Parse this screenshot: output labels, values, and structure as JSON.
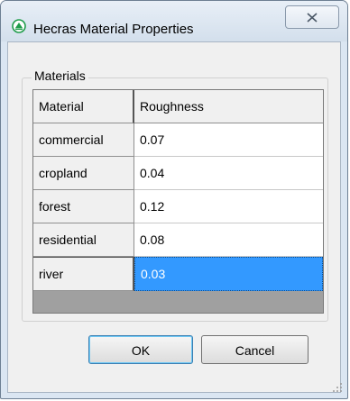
{
  "window": {
    "title": "Hecras Material Properties",
    "close_symbol": "✕"
  },
  "group": {
    "label": "Materials"
  },
  "table": {
    "columns": [
      "Material",
      "Roughness"
    ],
    "rows": [
      {
        "material": "commercial",
        "roughness": "0.07"
      },
      {
        "material": "cropland",
        "roughness": "0.04"
      },
      {
        "material": "forest",
        "roughness": "0.12"
      },
      {
        "material": "residential",
        "roughness": "0.08"
      },
      {
        "material": "river",
        "roughness": "0.03"
      }
    ],
    "selected_row": 4
  },
  "buttons": {
    "ok_label": "OK",
    "cancel_label": "Cancel"
  },
  "icons": {
    "app": "hecras-app-icon",
    "close": "close-icon",
    "resize": "resize-grip-icon"
  },
  "colors": {
    "selection": "#3399ff",
    "app_icon": "#1f9c4a"
  }
}
